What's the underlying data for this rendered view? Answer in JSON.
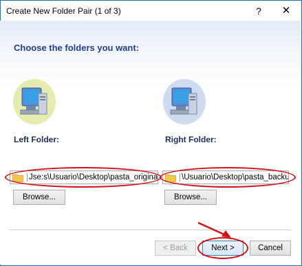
{
  "window": {
    "title": "Create New Folder Pair (1 of 3)",
    "help_glyph": "?",
    "close_glyph": "✕"
  },
  "heading": "Choose the folders you want:",
  "left": {
    "label": "Left Folder:",
    "path": "Jse:s\\Usuario\\Desktop\\pasta_original",
    "browse_label": "Browse..."
  },
  "right": {
    "label": "Right Folder:",
    "path": "\\Usuario\\Desktop\\pasta_backup",
    "browse_label": "Browse..."
  },
  "footer": {
    "back_label": "< Back",
    "next_label": "Next >",
    "cancel_label": "Cancel"
  },
  "colors": {
    "highlight": "#d41117",
    "heading": "#1f3f86",
    "left_icon_bg": "#e6ecb0",
    "right_icon_bg": "#cfdcef"
  },
  "icons": {
    "left_computer": "computer-icon",
    "right_computer": "computer-icon",
    "folder": "folder-icon"
  }
}
